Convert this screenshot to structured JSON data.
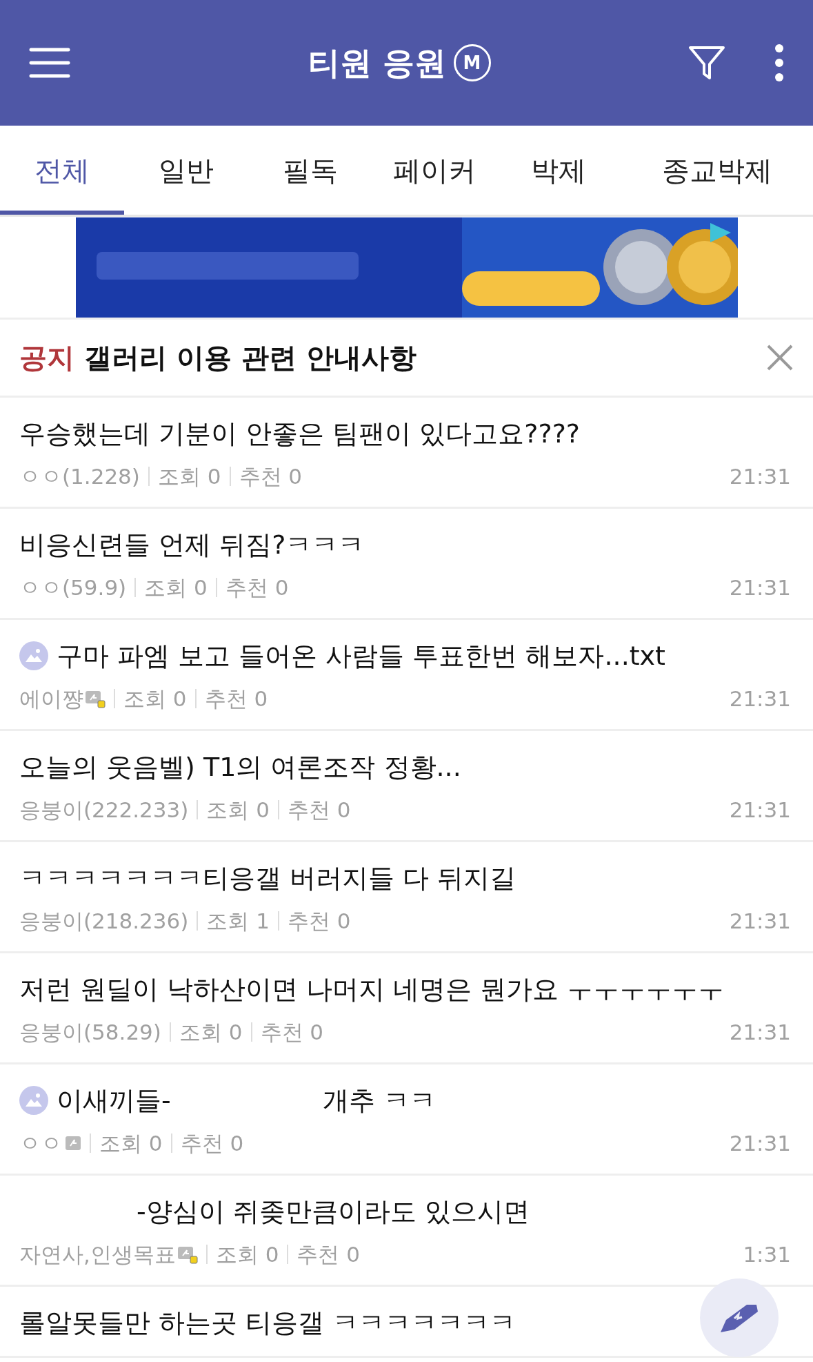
{
  "header": {
    "title": "티원 응원",
    "badge": "M"
  },
  "tabs": [
    {
      "label": "전체",
      "selected": true
    },
    {
      "label": "일반",
      "selected": false
    },
    {
      "label": "필독",
      "selected": false
    },
    {
      "label": "페이커",
      "selected": false
    },
    {
      "label": "박제",
      "selected": false
    },
    {
      "label": "종교박제",
      "selected": false
    }
  ],
  "notice": {
    "tag": "공지",
    "text": "갤러리 이용 관련 안내사항"
  },
  "posts": [
    {
      "title_parts": [
        "우승했는데 기분이 안좋은 팀팬이 있다고요????"
      ],
      "has_image": false,
      "writer": "ㅇㅇ(1.228)",
      "has_badge": false,
      "views": "조회 0",
      "recommends": "추천 0",
      "time": "21:31"
    },
    {
      "title_parts": [
        "비응신련들 언제 뒤짐?ㅋㅋㅋ"
      ],
      "has_image": false,
      "writer": "ㅇㅇ(59.9)",
      "has_badge": false,
      "views": "조회 0",
      "recommends": "추천 0",
      "time": "21:31"
    },
    {
      "title_parts": [
        "구마 파엠 보고 들어온 사람들 투표한번 해보자...txt"
      ],
      "has_image": true,
      "writer": "에이쨩",
      "has_badge": true,
      "badge_dot": true,
      "views": "조회 0",
      "recommends": "추천 0",
      "time": "21:31"
    },
    {
      "title_parts": [
        "오늘의 웃음벨) T1의 여론조작 정황..."
      ],
      "has_image": false,
      "writer": "응붕이(222.233)",
      "has_badge": false,
      "views": "조회 0",
      "recommends": "추천 0",
      "time": "21:31"
    },
    {
      "title_parts": [
        "ㅋㅋㅋㅋㅋㅋㅋ티응갤 버러지들 다 뒤지길"
      ],
      "has_image": false,
      "writer": "응붕이(218.236)",
      "has_badge": false,
      "views": "조회 1",
      "recommends": "추천 0",
      "time": "21:31"
    },
    {
      "title_parts": [
        "저런 원딜이 낙하산이면 나머지 네명은 뭔가요 ㅜㅜㅜㅜㅜㅜ"
      ],
      "has_image": false,
      "writer": "응붕이(58.29)",
      "has_badge": false,
      "views": "조회 0",
      "recommends": "추천 0",
      "time": "21:31"
    },
    {
      "title_parts": [
        "이새끼들-",
        "개추 ㅋㅋ"
      ],
      "has_image": true,
      "writer": "ㅇㅇ",
      "has_badge": true,
      "badge_dot": false,
      "views": "조회 0",
      "recommends": "추천 0",
      "time": "21:31"
    },
    {
      "title_parts": [
        "-양심이 쥐좆만큼이라도 있으시면"
      ],
      "redacted_start": true,
      "has_image": false,
      "writer": "자연사,인생목표",
      "has_badge": true,
      "badge_dot": true,
      "views": "조회 0",
      "recommends": "추천 0",
      "time": "1:31"
    },
    {
      "title_parts": [
        "롤알못들만 하는곳 티응갤 ㅋㅋㅋㅋㅋㅋㅋ"
      ],
      "has_image": false
    }
  ]
}
